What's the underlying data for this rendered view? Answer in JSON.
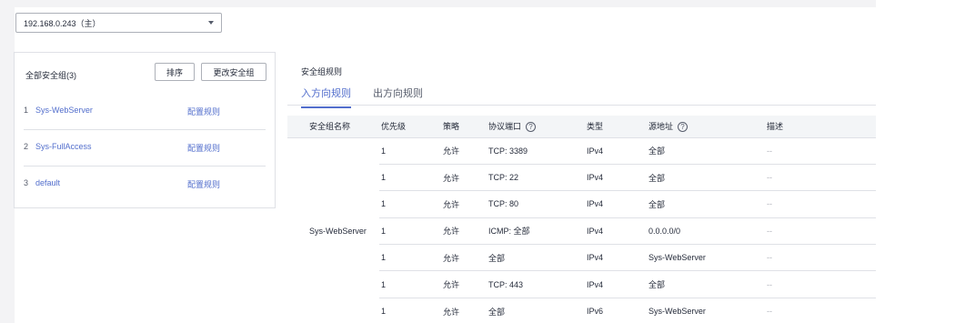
{
  "ip_select": {
    "value": "192.168.0.243（主）"
  },
  "security_groups": {
    "title": "全部安全组(3)",
    "sort_label": "排序",
    "change_label": "更改安全组",
    "items": [
      {
        "num": "1",
        "name": "Sys-WebServer",
        "action": "配置规则"
      },
      {
        "num": "2",
        "name": "Sys-FullAccess",
        "action": "配置规则"
      },
      {
        "num": "3",
        "name": "default",
        "action": "配置规则"
      }
    ]
  },
  "rules": {
    "title": "安全组规则",
    "tabs": [
      {
        "label": "入方向规则",
        "active": true
      },
      {
        "label": "出方向规则",
        "active": false
      }
    ],
    "columns": [
      "安全组名称",
      "优先级",
      "策略",
      "协议端口",
      "类型",
      "源地址",
      "描述"
    ],
    "group_name": "Sys-WebServer",
    "rows": [
      {
        "priority": "1",
        "policy": "允许",
        "port": "TCP: 3389",
        "type": "IPv4",
        "source": "全部",
        "desc": "--"
      },
      {
        "priority": "1",
        "policy": "允许",
        "port": "TCP: 22",
        "type": "IPv4",
        "source": "全部",
        "desc": "--"
      },
      {
        "priority": "1",
        "policy": "允许",
        "port": "TCP: 80",
        "type": "IPv4",
        "source": "全部",
        "desc": "--"
      },
      {
        "priority": "1",
        "policy": "允许",
        "port": "ICMP: 全部",
        "type": "IPv4",
        "source": "0.0.0.0/0",
        "desc": "--"
      },
      {
        "priority": "1",
        "policy": "允许",
        "port": "全部",
        "type": "IPv4",
        "source": "Sys-WebServer",
        "desc": "--"
      },
      {
        "priority": "1",
        "policy": "允许",
        "port": "TCP: 443",
        "type": "IPv4",
        "source": "全部",
        "desc": "--"
      },
      {
        "priority": "1",
        "policy": "允许",
        "port": "全部",
        "type": "IPv6",
        "source": "Sys-WebServer",
        "desc": "--"
      }
    ]
  },
  "colors": {
    "link": "#526ecc",
    "border": "#dfe1e6",
    "text": "#252b3a"
  }
}
